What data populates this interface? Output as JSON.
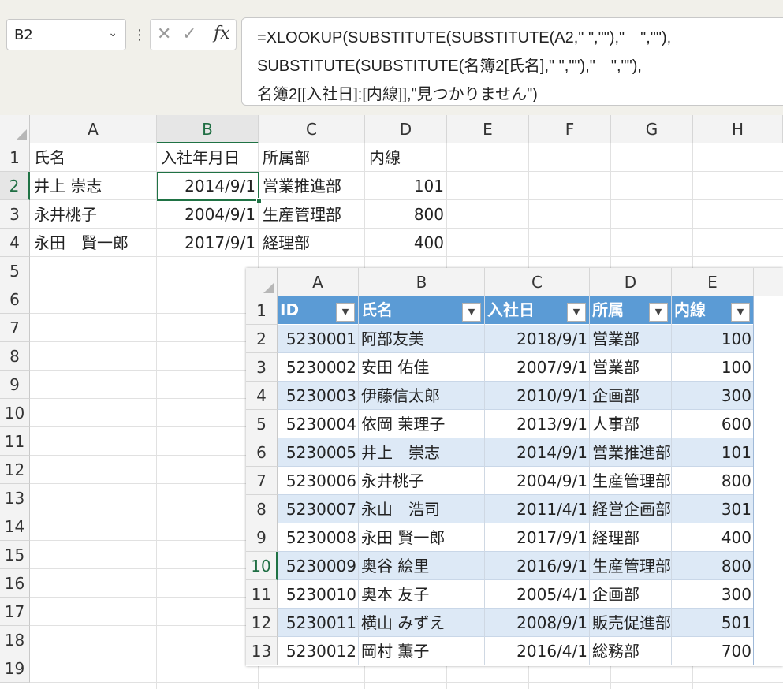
{
  "toolbar": {
    "name_box": "B2",
    "formula_lines": [
      "=XLOOKUP(SUBSTITUTE(SUBSTITUTE(A2,\" \",\"\"),\"　\",\"\"),",
      "SUBSTITUTE(SUBSTITUTE(名簿2[氏名],\" \",\"\"),\"　\",\"\"),",
      "名簿2[[入社日]:[内線]],\"見つかりません\")"
    ],
    "fx_label": "fx"
  },
  "sheet": {
    "columns": [
      "A",
      "B",
      "C",
      "D",
      "E",
      "F",
      "G",
      "H"
    ],
    "rows": [
      "1",
      "2",
      "3",
      "4",
      "5",
      "6",
      "7",
      "8",
      "9",
      "10",
      "11",
      "12",
      "13",
      "14",
      "15",
      "16",
      "17",
      "18",
      "19"
    ],
    "data": [
      [
        "氏名",
        "入社年月日",
        "所属部",
        "内線"
      ],
      [
        "井上 崇志",
        "2014/9/1",
        "営業推進部",
        "101"
      ],
      [
        "永井桃子",
        "2004/9/1",
        "生産管理部",
        "800"
      ],
      [
        "永田　賢一郎",
        "2017/9/1",
        "経理部",
        "400"
      ]
    ]
  },
  "embedded": {
    "columns": [
      "A",
      "B",
      "C",
      "D",
      "E"
    ],
    "rows": [
      "1",
      "2",
      "3",
      "4",
      "5",
      "6",
      "7",
      "8",
      "9",
      "10",
      "11",
      "12",
      "13"
    ],
    "headers": [
      "ID",
      "氏名",
      "入社日",
      "所属",
      "内線"
    ],
    "records": [
      [
        "5230001",
        "阿部友美",
        "2018/9/1",
        "営業部",
        "100"
      ],
      [
        "5230002",
        "安田 佑佳",
        "2007/9/1",
        "営業部",
        "100"
      ],
      [
        "5230003",
        "伊藤信太郎",
        "2010/9/1",
        "企画部",
        "300"
      ],
      [
        "5230004",
        "依岡 茉理子",
        "2013/9/1",
        "人事部",
        "600"
      ],
      [
        "5230005",
        "井上　崇志",
        "2014/9/1",
        "営業推進部",
        "101"
      ],
      [
        "5230006",
        "永井桃子",
        "2004/9/1",
        "生産管理部",
        "800"
      ],
      [
        "5230007",
        "永山　浩司",
        "2011/4/1",
        "経営企画部",
        "301"
      ],
      [
        "5230008",
        "永田 賢一郎",
        "2017/9/1",
        "経理部",
        "400"
      ],
      [
        "5230009",
        "奥谷 絵里",
        "2016/9/1",
        "生産管理部",
        "800"
      ],
      [
        "5230010",
        "奥本 友子",
        "2005/4/1",
        "企画部",
        "300"
      ],
      [
        "5230011",
        "横山 みずえ",
        "2008/9/1",
        "販売促進部",
        "501"
      ],
      [
        "5230012",
        "岡村 薫子",
        "2016/4/1",
        "総務部",
        "700"
      ]
    ]
  },
  "colors": {
    "accent": "#1f7244",
    "table_header": "#5b9bd5",
    "band": "#dde9f6"
  }
}
